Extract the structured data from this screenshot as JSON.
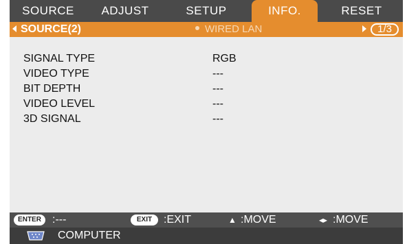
{
  "tabs": [
    "SOURCE",
    "ADJUST",
    "SETUP",
    "INFO.",
    "RESET"
  ],
  "active_tab_index": 3,
  "subheader": {
    "left": "SOURCE(2)",
    "center": "WIRED LAN",
    "page": "1/3"
  },
  "rows": [
    {
      "label": "SIGNAL TYPE",
      "value": "RGB"
    },
    {
      "label": "VIDEO TYPE",
      "value": "---"
    },
    {
      "label": "BIT DEPTH",
      "value": "---"
    },
    {
      "label": "VIDEO LEVEL",
      "value": "---"
    },
    {
      "label": "3D SIGNAL",
      "value": "---"
    }
  ],
  "footer": {
    "enter_key": "ENTER",
    "enter_action": ":---",
    "exit_key": "EXIT",
    "exit_action": ":EXIT",
    "move_vertical": ":MOVE",
    "move_horizontal": ":MOVE"
  },
  "status": {
    "source": "COMPUTER"
  },
  "colors": {
    "accent": "#e58d2e",
    "frame": "#3f3f3f",
    "content_bg": "#ececec"
  }
}
